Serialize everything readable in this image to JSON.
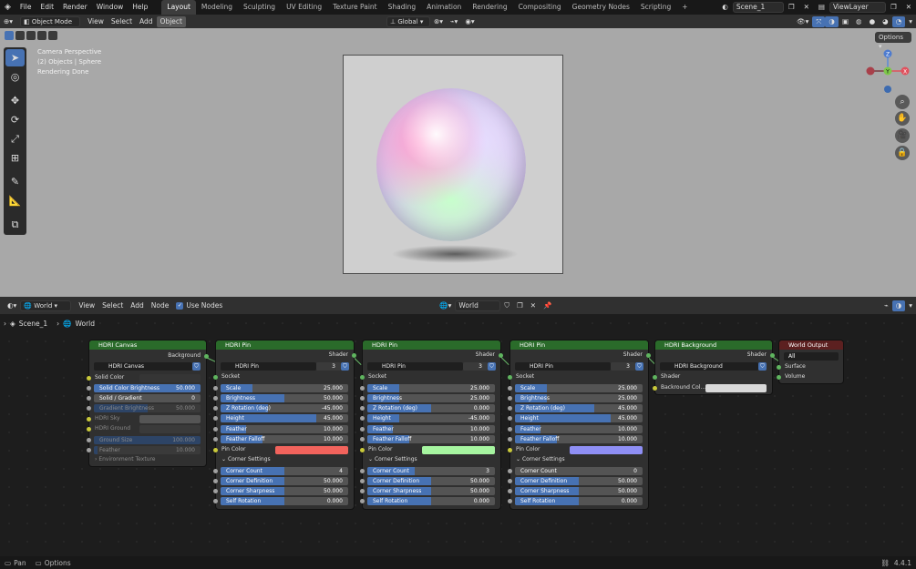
{
  "topbar": {
    "menus": [
      "File",
      "Edit",
      "Render",
      "Window",
      "Help"
    ],
    "workspaces": [
      "Layout",
      "Modeling",
      "Sculpting",
      "UV Editing",
      "Texture Paint",
      "Shading",
      "Animation",
      "Rendering",
      "Compositing",
      "Geometry Nodes",
      "Scripting"
    ],
    "add_tab": "+",
    "scene": "Scene_1",
    "view_layer": "ViewLayer"
  },
  "viewport_header": {
    "mode": "Object Mode",
    "menus": [
      "View",
      "Select",
      "Add",
      "Object"
    ],
    "transform_orientation": "Global",
    "options": "Options"
  },
  "viewport": {
    "overlay_lines": [
      "Camera Perspective",
      "(2) Objects | Sphere",
      "Rendering Done"
    ],
    "gizmo": {
      "z": "Z",
      "y": "Y",
      "x": "X"
    }
  },
  "node_header": {
    "editor": "World",
    "menus": [
      "View",
      "Select",
      "Add",
      "Node"
    ],
    "use_nodes": "Use Nodes",
    "datablock": "World"
  },
  "breadcrumb": {
    "scene": "Scene_1",
    "world": "World"
  },
  "nodes": {
    "canvas": {
      "title": "HDRI Canvas",
      "output": "Background",
      "datablock": "HDRI Canvas",
      "solid_color": "Solid Color",
      "fields": [
        {
          "label": "Solid Color Brightness",
          "value": "50.000"
        },
        {
          "label": "Solid / Gradient",
          "value": "0"
        },
        {
          "label": "Gradient Brightness",
          "value": "50.000"
        }
      ],
      "hdri_sky": "HDRI Sky",
      "hdri_ground": "HDRI Ground",
      "fields2": [
        {
          "label": "Ground Size",
          "value": "100.000"
        },
        {
          "label": "Feather",
          "value": "10.000"
        }
      ],
      "env_texture": "Environment Texture"
    },
    "pins": [
      {
        "title": "HDRI Pin",
        "output": "Shader",
        "datablock": "HDRI Pin",
        "users": "3",
        "socket": "Socket",
        "fields": [
          {
            "label": "Scale",
            "value": "25.000",
            "fill": 0.25
          },
          {
            "label": "Brightness",
            "value": "50.000",
            "fill": 0.5
          },
          {
            "label": "Z Rotation (deg)",
            "value": "-45.000",
            "fill": 0.37
          },
          {
            "label": "Height",
            "value": "45.000",
            "fill": 0.75
          },
          {
            "label": "Feather",
            "value": "10.000",
            "fill": 0.2
          },
          {
            "label": "Feather Falloff",
            "value": "10.000",
            "fill": 0.33
          }
        ],
        "pin_color_label": "Pin Color",
        "pin_color": "#f2635c",
        "corner_settings": "Corner Settings",
        "corner": [
          {
            "label": "Corner Count",
            "value": "4",
            "fill": 0.5
          },
          {
            "label": "Corner Definition",
            "value": "50.000",
            "fill": 0.5
          },
          {
            "label": "Corner Sharpness",
            "value": "50.000",
            "fill": 0.5
          },
          {
            "label": "Self Rotation",
            "value": "0.000",
            "fill": 0.5
          }
        ]
      },
      {
        "title": "HDRI Pin",
        "output": "Shader",
        "datablock": "HDRI Pin",
        "users": "3",
        "socket": "Socket",
        "fields": [
          {
            "label": "Scale",
            "value": "25.000",
            "fill": 0.25
          },
          {
            "label": "Brightness",
            "value": "25.000",
            "fill": 0.25
          },
          {
            "label": "Z Rotation (deg)",
            "value": "0.000",
            "fill": 0.5
          },
          {
            "label": "Height",
            "value": "-45.000",
            "fill": 0.25
          },
          {
            "label": "Feather",
            "value": "10.000",
            "fill": 0.2
          },
          {
            "label": "Feather Falloff",
            "value": "10.000",
            "fill": 0.33
          }
        ],
        "pin_color_label": "Pin Color",
        "pin_color": "#a6f5a0",
        "corner_settings": "Corner Settings",
        "corner": [
          {
            "label": "Corner Count",
            "value": "3",
            "fill": 0.37
          },
          {
            "label": "Corner Definition",
            "value": "50.000",
            "fill": 0.5
          },
          {
            "label": "Corner Sharpness",
            "value": "50.000",
            "fill": 0.5
          },
          {
            "label": "Self Rotation",
            "value": "0.000",
            "fill": 0.5
          }
        ]
      },
      {
        "title": "HDRI Pin",
        "output": "Shader",
        "datablock": "HDRI Pin",
        "users": "3",
        "socket": "Socket",
        "fields": [
          {
            "label": "Scale",
            "value": "25.000",
            "fill": 0.25
          },
          {
            "label": "Brightness",
            "value": "25.000",
            "fill": 0.25
          },
          {
            "label": "Z Rotation (deg)",
            "value": "45.000",
            "fill": 0.62
          },
          {
            "label": "Height",
            "value": "45.000",
            "fill": 0.75
          },
          {
            "label": "Feather",
            "value": "10.000",
            "fill": 0.2
          },
          {
            "label": "Feather Falloff",
            "value": "10.000",
            "fill": 0.33
          }
        ],
        "pin_color_label": "Pin Color",
        "pin_color": "#8f8ff5",
        "corner_settings": "Corner Settings",
        "corner": [
          {
            "label": "Corner Count",
            "value": "0",
            "fill": 0
          },
          {
            "label": "Corner Definition",
            "value": "50.000",
            "fill": 0.5
          },
          {
            "label": "Corner Sharpness",
            "value": "50.000",
            "fill": 0.5
          },
          {
            "label": "Self Rotation",
            "value": "0.000",
            "fill": 0.5
          }
        ]
      }
    ],
    "background": {
      "title": "HDRI Background",
      "output": "Shader",
      "datablock": "HDRI Background",
      "shader": "Shader",
      "bg_color_label": "Backround Col...",
      "bg_color": "#d9d9d9"
    },
    "output": {
      "title": "World Output",
      "target": "All",
      "surface": "Surface",
      "volume": "Volume"
    }
  },
  "status": {
    "left": "Pan",
    "mid": "Options",
    "version": "4.4.1"
  },
  "colors": {
    "accent": "#4772b3",
    "node_header_green": "#2a6b2a",
    "output_header": "#5c2020"
  }
}
